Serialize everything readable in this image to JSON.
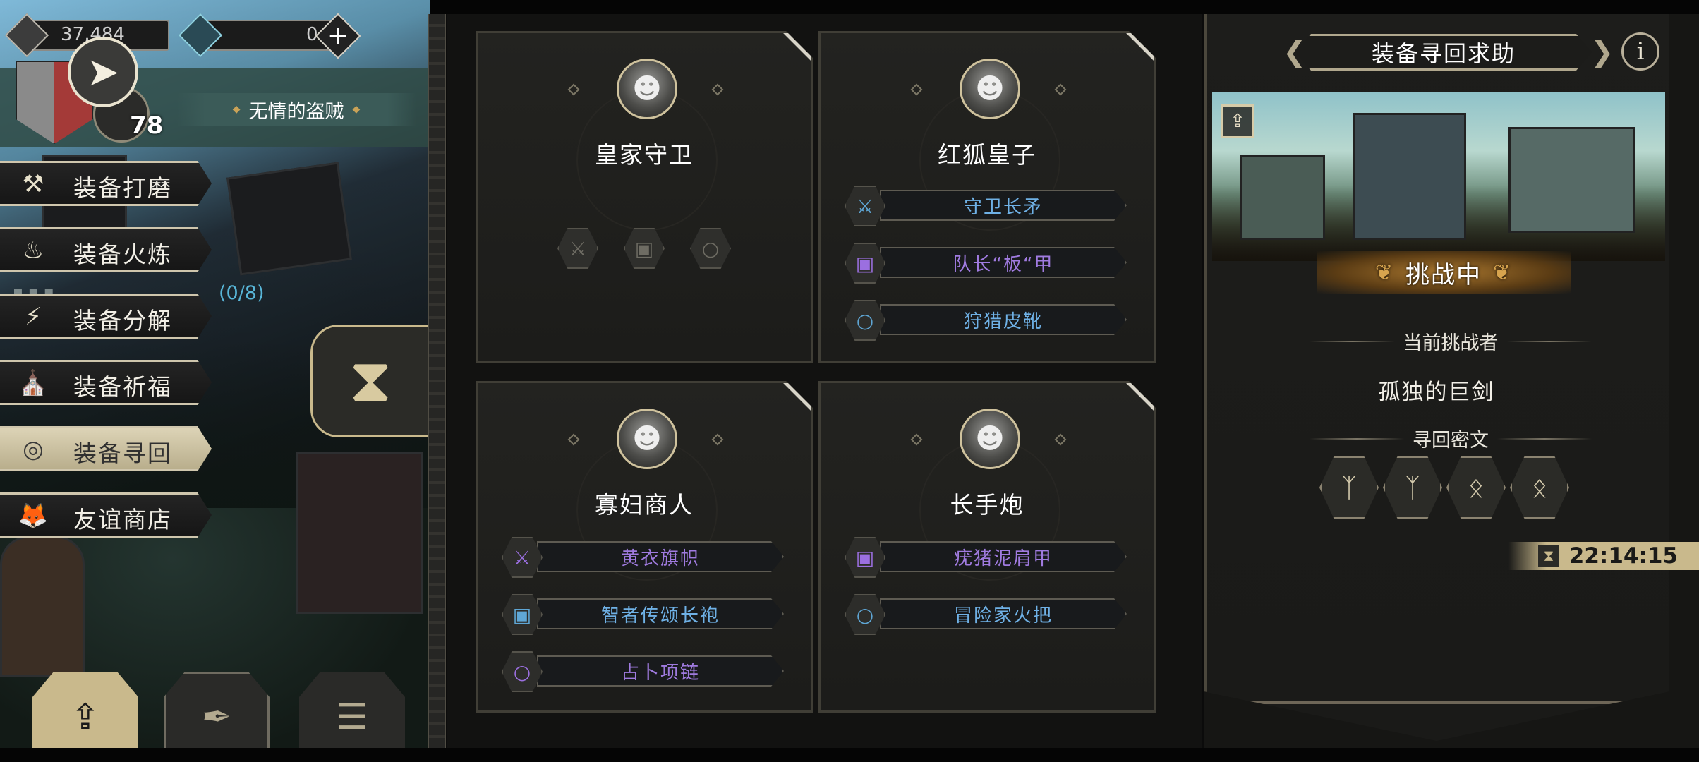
{
  "resources": {
    "coins": "37,484",
    "gems": "0"
  },
  "player": {
    "level": "78",
    "title": "无情的盗贼"
  },
  "menu": {
    "items": [
      {
        "label": "装备打磨",
        "icon": "hammer-icon"
      },
      {
        "label": "装备火炼",
        "icon": "fire-icon"
      },
      {
        "label": "装备分解",
        "icon": "split-icon"
      },
      {
        "label": "装备祈福",
        "icon": "pray-icon"
      },
      {
        "label": "装备寻回",
        "icon": "target-icon"
      },
      {
        "label": "友谊商店",
        "icon": "fox-icon"
      }
    ],
    "active": "装备寻回",
    "progress": "(0/8)"
  },
  "cards": [
    {
      "name": "皇家守卫",
      "items": []
    },
    {
      "name": "红狐皇子",
      "items": [
        {
          "label": "守卫长矛",
          "type": "sword-icon",
          "rarity": "blue"
        },
        {
          "label": "队长“板“甲",
          "type": "armor-icon",
          "rarity": "purple"
        },
        {
          "label": "狩猎皮靴",
          "type": "ring-icon",
          "rarity": "blue"
        }
      ]
    },
    {
      "name": "寡妇商人",
      "items": [
        {
          "label": "黄衣旗帜",
          "type": "sword-icon",
          "rarity": "purple"
        },
        {
          "label": "智者传颂长袍",
          "type": "armor-icon",
          "rarity": "blue"
        },
        {
          "label": "占卜项链",
          "type": "ring-icon",
          "rarity": "purple"
        }
      ]
    },
    {
      "name": "长手炮",
      "items": [
        {
          "label": "疣猪泥肩甲",
          "type": "armor-icon",
          "rarity": "purple"
        },
        {
          "label": "冒险家火把",
          "type": "ring-icon",
          "rarity": "blue"
        }
      ]
    }
  ],
  "right_panel": {
    "title": "装备寻回求助",
    "info": "i",
    "status": "挑战中",
    "challenger_label": "当前挑战者",
    "challenger_name": "孤独的巨剑",
    "runes_label": "寻回密文",
    "runes": [
      "rune-a-icon",
      "rune-a-icon",
      "rune-b-icon",
      "rune-b-icon"
    ],
    "timer": "22:14:15"
  },
  "colors": {
    "blue_item": "#6fb1e6",
    "purple_item": "#a07be0",
    "gold_accent": "#c9b98c"
  }
}
